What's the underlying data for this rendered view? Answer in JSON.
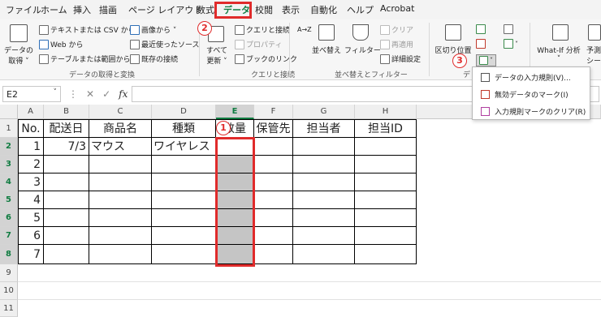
{
  "menu": {
    "items": [
      "ファイル",
      "ホーム",
      "挿入",
      "描画",
      "ページ レイアウト",
      "数式",
      "データ",
      "校閲",
      "表示",
      "自動化",
      "ヘルプ",
      "Acrobat"
    ],
    "active": "データ"
  },
  "ribbon": {
    "get_data_label": "データの\n取得",
    "get_data_line1": "データの",
    "get_data_line2": "取得 ˅",
    "text_csv": "テキストまたは CSV から",
    "web": "Web から",
    "table_range": "テーブルまたは範囲から",
    "images": "画像から ˅",
    "recent_sources": "最近使ったソース",
    "existing_conn": "既存の接続",
    "group_get_transform": "データの取得と変換",
    "refresh_all_line1": "すべて",
    "refresh_all_line2": "更新 ˅",
    "queries_conn": "クエリと接続",
    "properties": "プロパティ",
    "edit_links": "ブックのリンク",
    "group_queries": "クエリと接続",
    "sort_asc": "A→Z",
    "sort": "並べ替え",
    "filter": "フィルター",
    "clear": "クリア",
    "reapply": "再適用",
    "advanced": "詳細設定",
    "group_sort_filter": "並べ替えとフィルター",
    "text_to_columns": "区切り位置",
    "whatif": "What-If 分析",
    "whatif_arrow": "˅",
    "forecast_line1": "予測",
    "forecast_line2": "シー",
    "group_data_tools_partial": "デ"
  },
  "formula_bar": {
    "name_box": "E2",
    "fx": "fx",
    "value": ""
  },
  "grid": {
    "columns": [
      "A",
      "B",
      "C",
      "D",
      "E",
      "F",
      "G",
      "H"
    ],
    "rows": [
      "1",
      "2",
      "3",
      "4",
      "5",
      "6",
      "7",
      "8",
      "9",
      "10",
      "11"
    ],
    "headers": [
      "No.",
      "配送日",
      "商品名",
      "種類",
      "数量",
      "保管先",
      "担当者",
      "担当ID"
    ],
    "row2": {
      "no": "1",
      "date": "7/3",
      "product": "マウス",
      "kind": "ワイヤレス"
    },
    "numbers": [
      "2",
      "3",
      "4",
      "5",
      "6",
      "7"
    ]
  },
  "annotations": {
    "badge1": "1",
    "badge2": "2",
    "badge3": "3"
  },
  "dropdown": {
    "items": [
      "データの入力規則(V)...",
      "無効データのマーク(I)",
      "入力規則マークのクリア(R)"
    ]
  },
  "colors": {
    "accent": "#107c41",
    "annotation_red": "#e02b2b",
    "selected_fill": "#c5c5c5"
  }
}
